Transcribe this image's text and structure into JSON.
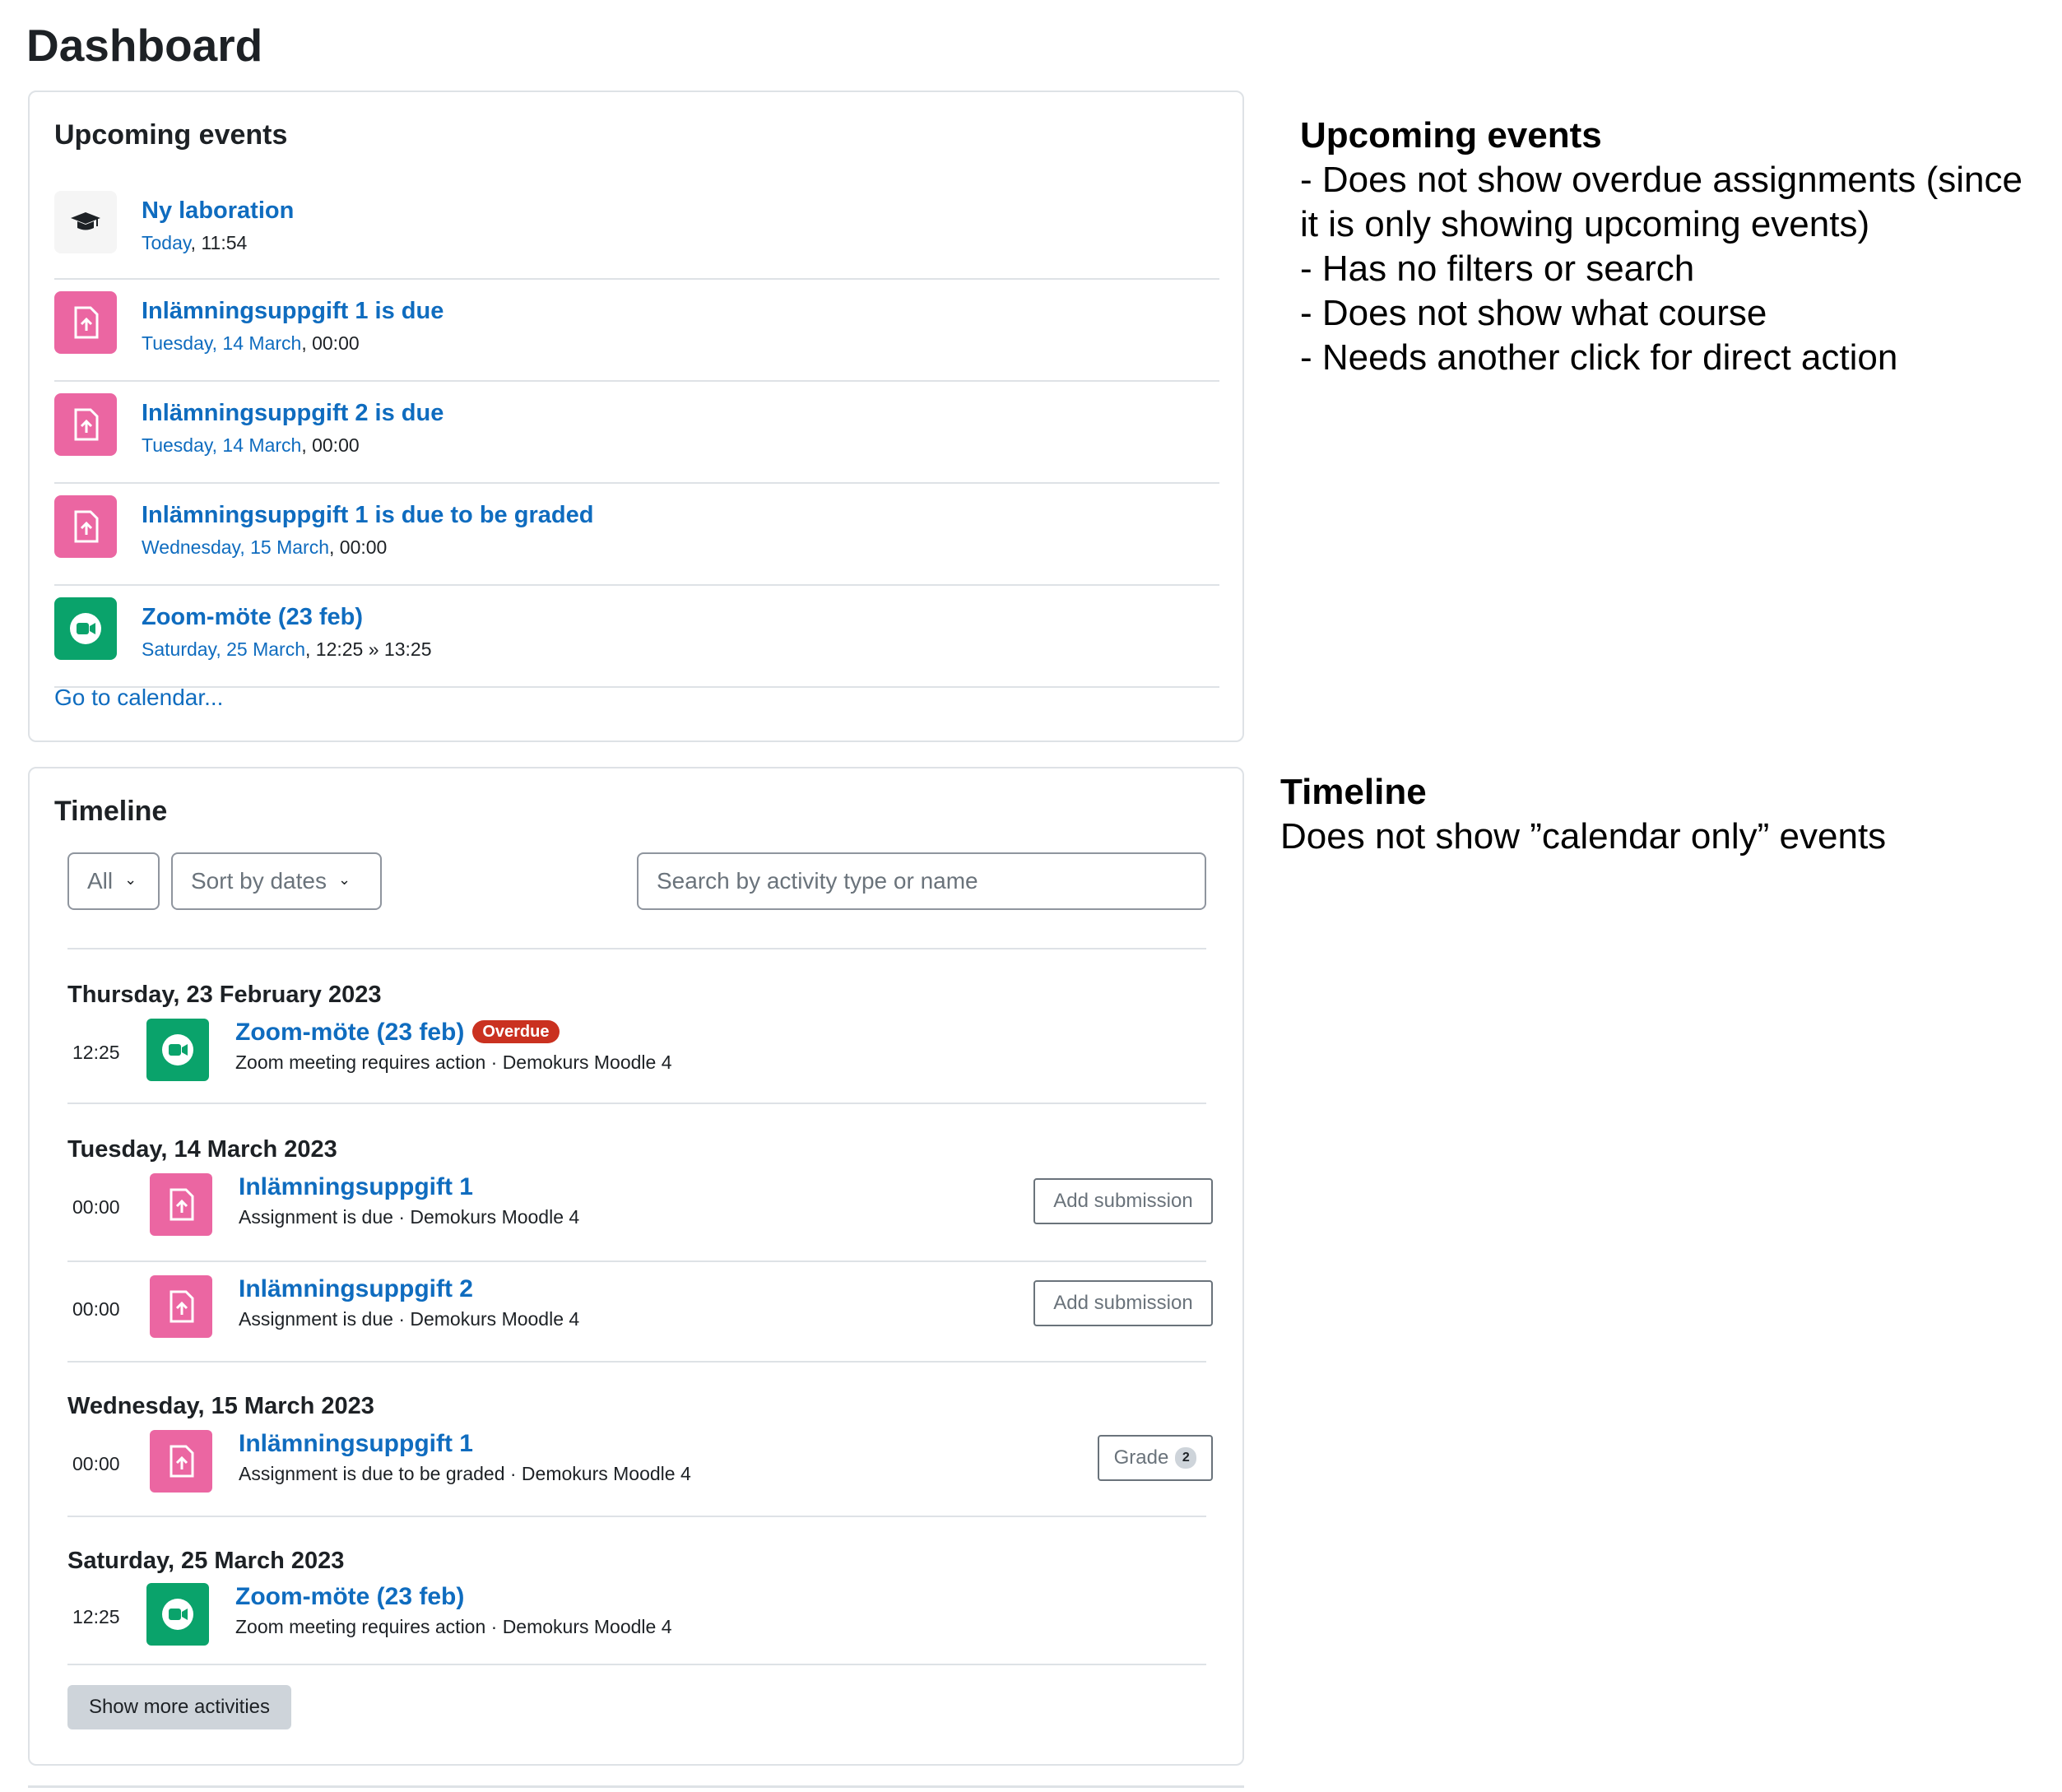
{
  "page": {
    "title": "Dashboard"
  },
  "upcoming": {
    "title": "Upcoming events",
    "items": [
      {
        "title": "Ny laboration",
        "date_link": "Today",
        "date_rest": ", 11:54",
        "icon": "graduation-cap-icon"
      },
      {
        "title": "Inlämningsuppgift 1 is due",
        "date_link": "Tuesday, 14 March",
        "date_rest": ", 00:00",
        "icon": "assignment-icon"
      },
      {
        "title": "Inlämningsuppgift 2 is due",
        "date_link": "Tuesday, 14 March",
        "date_rest": ", 00:00",
        "icon": "assignment-icon"
      },
      {
        "title": "Inlämningsuppgift 1 is due to be graded",
        "date_link": "Wednesday, 15 March",
        "date_rest": ", 00:00",
        "icon": "assignment-icon"
      },
      {
        "title": "Zoom-möte (23 feb)",
        "date_link": "Saturday, 25 March",
        "date_rest": ", 12:25 » 13:25",
        "icon": "zoom-icon"
      }
    ],
    "go_calendar": "Go to calendar..."
  },
  "timeline": {
    "title": "Timeline",
    "filter_label": "All",
    "sort_label": "Sort by dates",
    "search_placeholder": "Search by activity type or name",
    "groups": [
      {
        "date": "Thursday, 23 February 2023",
        "items": [
          {
            "time": "12:25",
            "title": "Zoom-möte (23 feb)",
            "badge": "Overdue",
            "sub": "Zoom meeting requires action · Demokurs Moodle 4",
            "icon": "zoom-icon"
          }
        ]
      },
      {
        "date": "Tuesday, 14 March 2023",
        "items": [
          {
            "time": "00:00",
            "title": "Inlämningsuppgift 1",
            "sub": "Assignment is due · Demokurs Moodle 4",
            "action": "Add submission",
            "icon": "assignment-icon"
          },
          {
            "time": "00:00",
            "title": "Inlämningsuppgift 2",
            "sub": "Assignment is due · Demokurs Moodle 4",
            "action": "Add submission",
            "icon": "assignment-icon"
          }
        ]
      },
      {
        "date": "Wednesday, 15 March 2023",
        "items": [
          {
            "time": "00:00",
            "title": "Inlämningsuppgift 1",
            "sub": "Assignment is due to be graded · Demokurs Moodle 4",
            "action": "Grade",
            "action_count": "2",
            "icon": "assignment-icon"
          }
        ]
      },
      {
        "date": "Saturday, 25 March 2023",
        "items": [
          {
            "time": "12:25",
            "title": "Zoom-möte (23 feb)",
            "sub": "Zoom meeting requires action · Demokurs Moodle 4",
            "icon": "zoom-icon"
          }
        ]
      }
    ],
    "show_more": "Show more activities"
  },
  "notes": {
    "upcoming": {
      "title": "Upcoming events",
      "lines": [
        "- Does not show overdue assignments (since it is only showing upcoming events)",
        "- Has no filters or search",
        "- Does not show what course",
        "- Needs another click for direct action"
      ]
    },
    "timeline": {
      "title": "Timeline",
      "lines": [
        "Does not show ”calendar only” events"
      ]
    }
  },
  "colors": {
    "link": "#0f6cbf",
    "assignment": "#eb66a2",
    "zoom": "#0aa36b",
    "overdue": "#ca3120",
    "border": "#dee2e6"
  }
}
